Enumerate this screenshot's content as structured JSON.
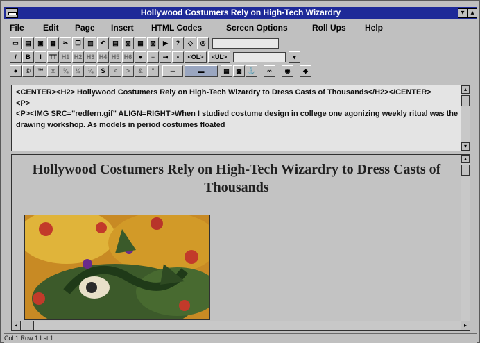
{
  "window": {
    "title": "Hollywood Costumers Rely on High-Tech Wizardry",
    "min_glyph": "▾",
    "max_glyph": "▴"
  },
  "menu": [
    {
      "label": "File",
      "hotkey": "F"
    },
    {
      "label": "Edit",
      "hotkey": "E"
    },
    {
      "label": "Page",
      "hotkey": "P"
    },
    {
      "label": "Insert",
      "hotkey": "I"
    },
    {
      "label": "HTML Codes",
      "hotkey": "H"
    },
    {
      "label": "Screen Options",
      "hotkey": "S"
    },
    {
      "label": "Roll Ups",
      "hotkey": "R"
    },
    {
      "label": "Help",
      "hotkey": "H"
    }
  ],
  "toolbar_row2": {
    "b": "B",
    "i": "I",
    "tt": "TT",
    "h1": "H1",
    "h2": "H2",
    "h3": "H3",
    "h4": "H4",
    "h5": "H5",
    "h6": "H6",
    "ol": "<OL>",
    "ul": "<UL>"
  },
  "toolbar_row3": {
    "tm": "™",
    "s": "S"
  },
  "source": {
    "html": "<CENTER><H2> Hollywood Costumers Rely on High-Tech Wizardry to Dress Casts of Thousands</H2></CENTER>\n<P>\n<P><IMG SRC=\"redfern.gif\" ALIGN=RIGHT>When I studied costume design in college one agonizing weekly ritual was the drawing workshop. As models in period costumes floated"
  },
  "preview": {
    "heading": "Hollywood Costumers Rely on High-Tech Wizardry to Dress Casts of Thousands"
  },
  "status": {
    "text": "Col 1   Row 1   Lst 1"
  },
  "colors": {
    "titlebar": "#1e2a98",
    "chrome": "#c0c0c0",
    "source_bg": "#e4e4e4"
  }
}
